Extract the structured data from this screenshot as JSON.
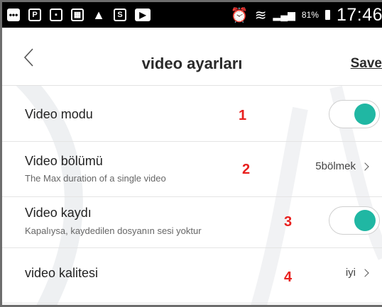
{
  "status_bar": {
    "battery": "81%",
    "time": "17:46"
  },
  "header": {
    "title": "video ayarları",
    "save_label": "Save"
  },
  "rows": [
    {
      "label": "Video modu",
      "annotation": "1",
      "toggle_on": true
    },
    {
      "label": "Video bölümü",
      "sublabel": "The Max duration of a single video",
      "annotation": "2",
      "value": "5bölmek"
    },
    {
      "label": "Video kaydı",
      "sublabel": "Kapalıysa, kaydedilen dosyanın sesi yoktur",
      "annotation": "3",
      "toggle_on": true
    },
    {
      "label": "video kalitesi",
      "annotation": "4",
      "value": "iyi"
    }
  ],
  "colors": {
    "accent": "#20b7a3",
    "annotation": "#e8201e"
  }
}
